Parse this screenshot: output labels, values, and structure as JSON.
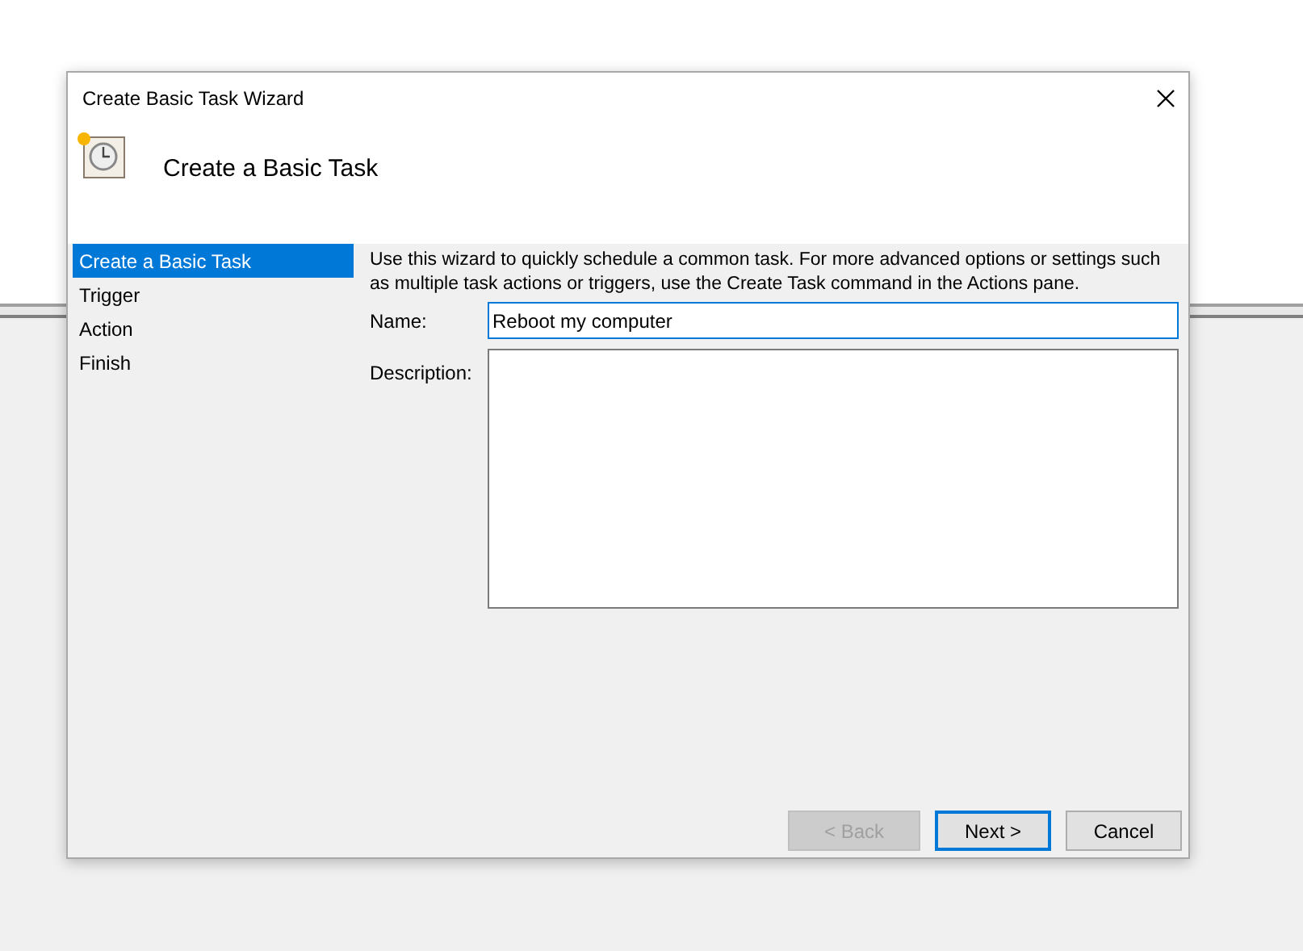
{
  "window": {
    "title": "Create Basic Task Wizard"
  },
  "header": {
    "title": "Create a Basic Task"
  },
  "steps": [
    {
      "label": "Create a Basic Task",
      "selected": true
    },
    {
      "label": "Trigger",
      "selected": false
    },
    {
      "label": "Action",
      "selected": false
    },
    {
      "label": "Finish",
      "selected": false
    }
  ],
  "intro": "Use this wizard to quickly schedule a common task.  For more advanced options or settings such as multiple task actions or triggers, use the Create Task command in the Actions pane.",
  "name_field": {
    "label": "Name:",
    "value": "Reboot my computer"
  },
  "description_field": {
    "label": "Description:"
  },
  "buttons": [
    {
      "label": "< Back",
      "disabled": true,
      "default": false
    },
    {
      "label": "Next >",
      "disabled": false,
      "default": true
    },
    {
      "label": "Cancel",
      "disabled": false,
      "default": false
    }
  ]
}
